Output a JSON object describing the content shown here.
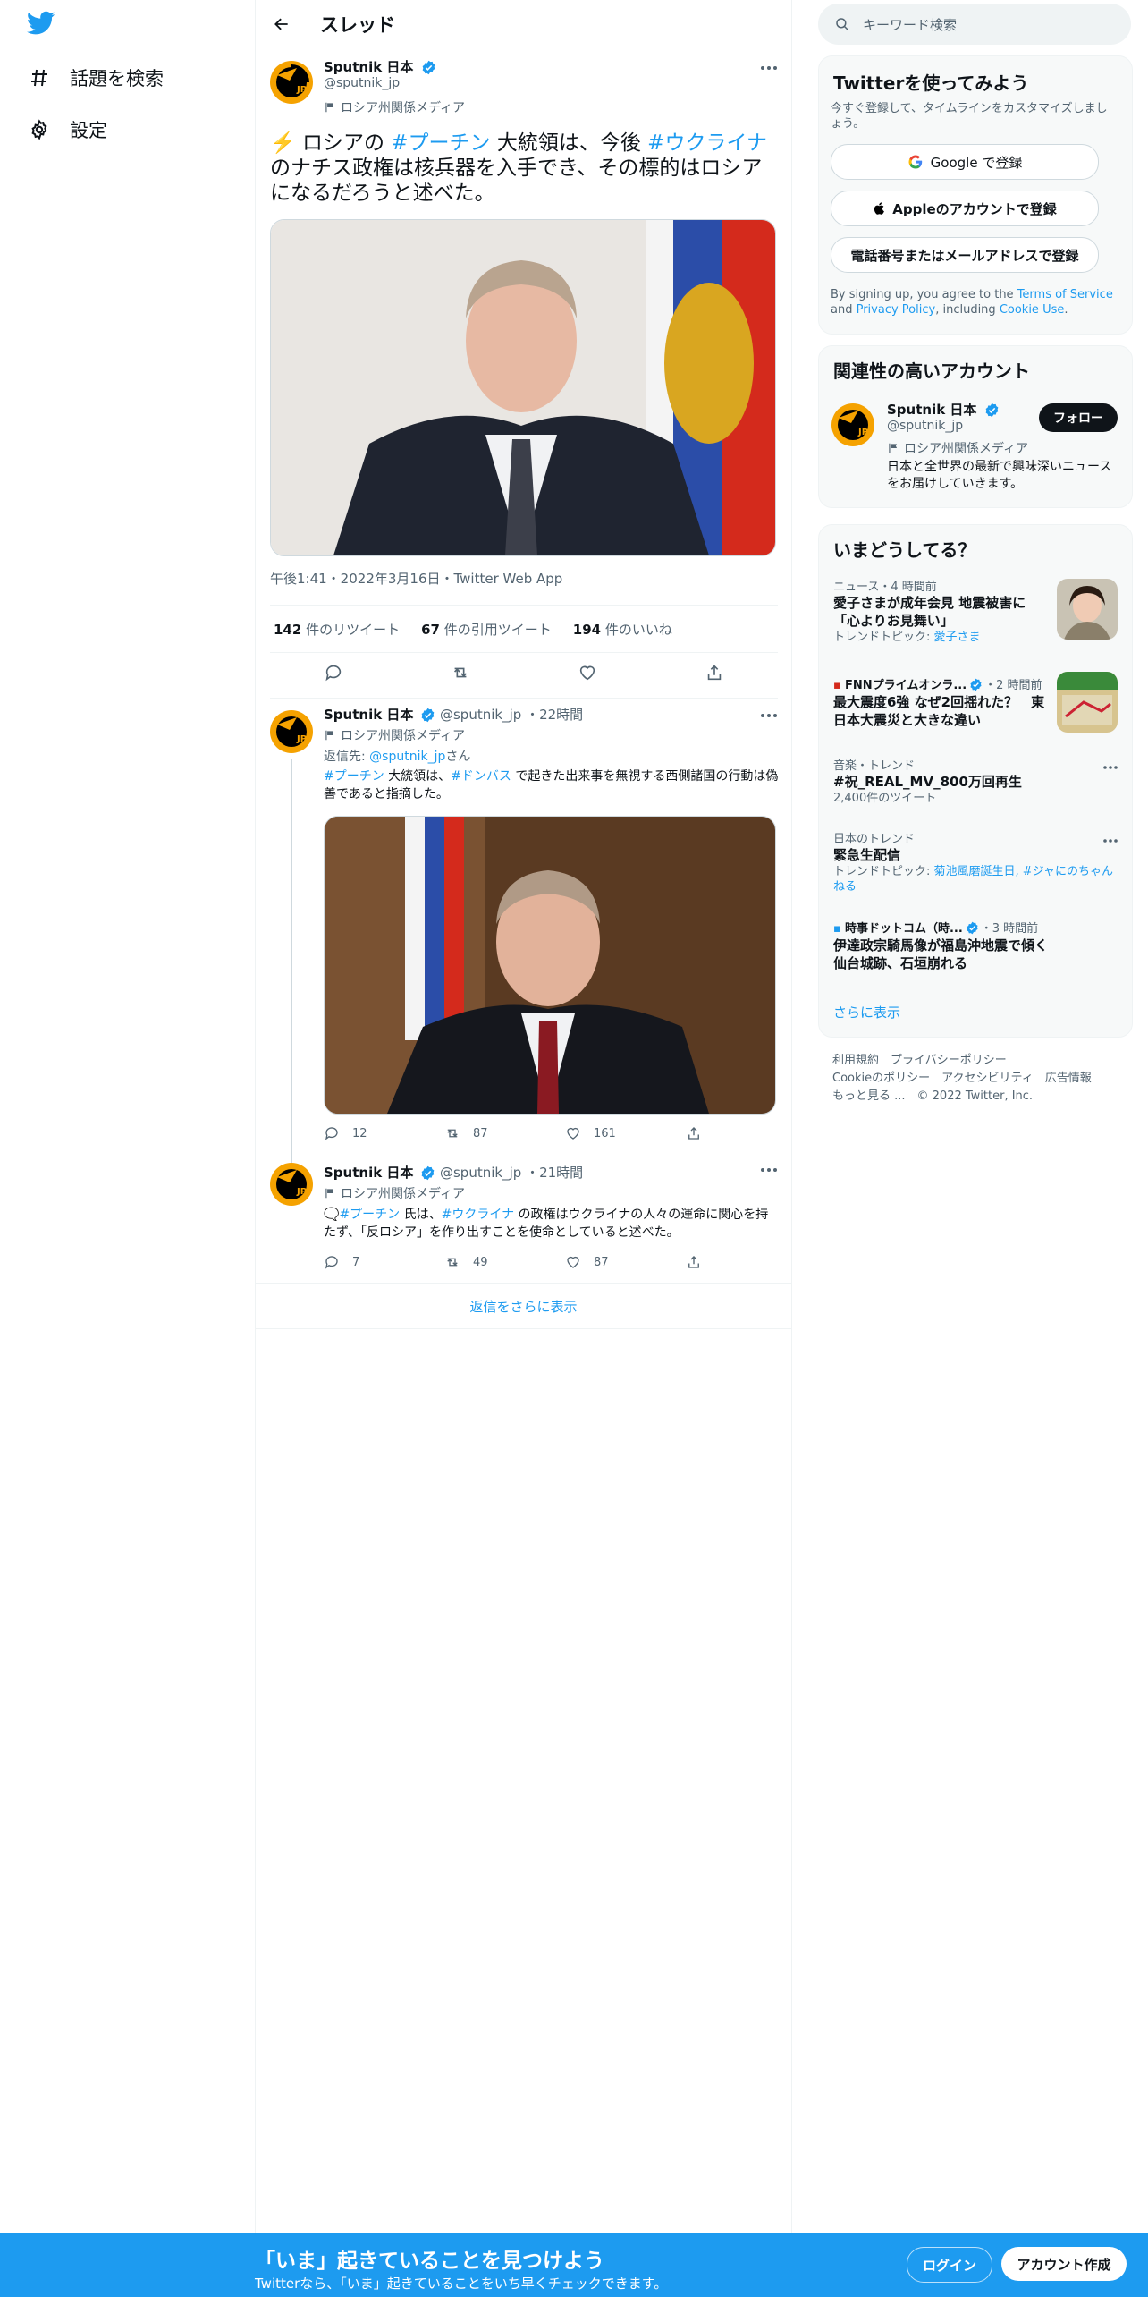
{
  "colors": {
    "accent": "#1d9bf0",
    "text": "#0f1419",
    "muted": "#536471"
  },
  "sidebar": {
    "items": [
      {
        "icon": "hashtag-icon",
        "label": "話題を検索"
      },
      {
        "icon": "gear-icon",
        "label": "設定"
      }
    ]
  },
  "header": {
    "title": "スレッド"
  },
  "main_tweet": {
    "name": "Sputnik 日本",
    "handle": "@sputnik_jp",
    "label": "ロシア州関係メディア",
    "text_parts": {
      "emoji": "⚡️",
      "t1": " ロシアの ",
      "tag1": "#プーチン",
      "t2": " 大統領は、今後 ",
      "tag2": "#ウクライナ",
      "t3": " のナチス政権は核兵器を入手でき、その標的はロシアになるだろうと述べた。"
    },
    "meta": "午後1:41・2022年3月16日・Twitter Web App",
    "stats": [
      {
        "num": "142",
        "label": "件のリツイート"
      },
      {
        "num": "67",
        "label": "件の引用ツイート"
      },
      {
        "num": "194",
        "label": "件のいいね"
      }
    ]
  },
  "replies": [
    {
      "name": "Sputnik 日本",
      "handle": "@sputnik_jp",
      "time": "22時間",
      "label": "ロシア州関係メディア",
      "reply_to_prefix": "返信先: ",
      "reply_to_handle": "@sputnik_jp",
      "reply_to_suffix": "さん",
      "tag1": "#プーチン",
      "t1": " 大統領は、",
      "tag2": "#ドンバス",
      "t2": " で起きた出来事を無視する西側諸国の行動は偽善であると指摘した。",
      "reply_count": "12",
      "retweet_count": "87",
      "like_count": "161"
    },
    {
      "name": "Sputnik 日本",
      "handle": "@sputnik_jp",
      "time": "21時間",
      "label": "ロシア州関係メディア",
      "emoji": "🗨️",
      "tag1": "#プーチン",
      "t1": " 氏は、",
      "tag2": "#ウクライナ",
      "t2": " の政権はウクライナの人々の運命に関心を持たず、「反ロシア」を作り出すことを使命としていると述べた。",
      "reply_count": "7",
      "retweet_count": "49",
      "like_count": "87"
    }
  ],
  "show_more": "返信をさらに表示",
  "search": {
    "placeholder": "キーワード検索"
  },
  "signup_card": {
    "title": "Twitterを使ってみよう",
    "subtitle": "今すぐ登録して、タイムラインをカスタマイズしましょう。",
    "google": "Google で登録",
    "apple": "Appleのアカウントで登録",
    "phone": "電話番号またはメールアドレスで登録",
    "terms_1": "By signing up, you agree to the ",
    "terms_link1": "Terms of Service",
    "terms_2": " and ",
    "terms_link2": "Privacy Policy",
    "terms_3": ", including ",
    "terms_link3": "Cookie Use",
    "terms_4": "."
  },
  "related_card": {
    "title": "関連性の高いアカウント",
    "name": "Sputnik 日本",
    "handle": "@sputnik_jp",
    "label": "ロシア州関係メディア",
    "bio": "日本と全世界の最新で興味深いニュースをお届けしていきます。",
    "follow": "フォロー"
  },
  "trends_card": {
    "title": "いまどうしてる？",
    "items": [
      {
        "meta": "ニュース・4 時間前",
        "title": "愛子さまが成年会見 地震被害に「心よりお見舞い」",
        "sub_prefix": "トレンドトピック: ",
        "sub_link": "愛子さま"
      },
      {
        "meta_name": "FNNプライムオンラ...",
        "meta_time": "・2 時間前",
        "title": "最大震度6強 なぜ2回揺れた？　東日本大震災と大きな違い"
      },
      {
        "meta": "音楽・トレンド",
        "title": "#祝_REAL_MV_800万回再生",
        "sub": "2,400件のツイート"
      },
      {
        "meta": "日本のトレンド",
        "title": "緊急生配信",
        "sub_prefix": "トレンドトピック: ",
        "sub_link": "菊池風磨誕生日, #ジャにのちゃんねる"
      },
      {
        "meta_name": "時事ドットコム（時...",
        "meta_time": "・3 時間前",
        "title": "伊達政宗騎馬像が福島沖地震で傾く　仙台城跡、石垣崩れる"
      }
    ],
    "show_more": "さらに表示"
  },
  "footer": {
    "line1": "利用規約　プライバシーポリシー",
    "line2": "Cookieのポリシー　アクセシビリティ　広告情報",
    "line3": "もっと見る ...　© 2022 Twitter, Inc."
  },
  "bottom_bar": {
    "title": "「いま」起きていることを見つけよう",
    "subtitle": "Twitterなら、「いま」起きていることをいち早くチェックできます。",
    "login": "ログイン",
    "signup": "アカウント作成"
  }
}
